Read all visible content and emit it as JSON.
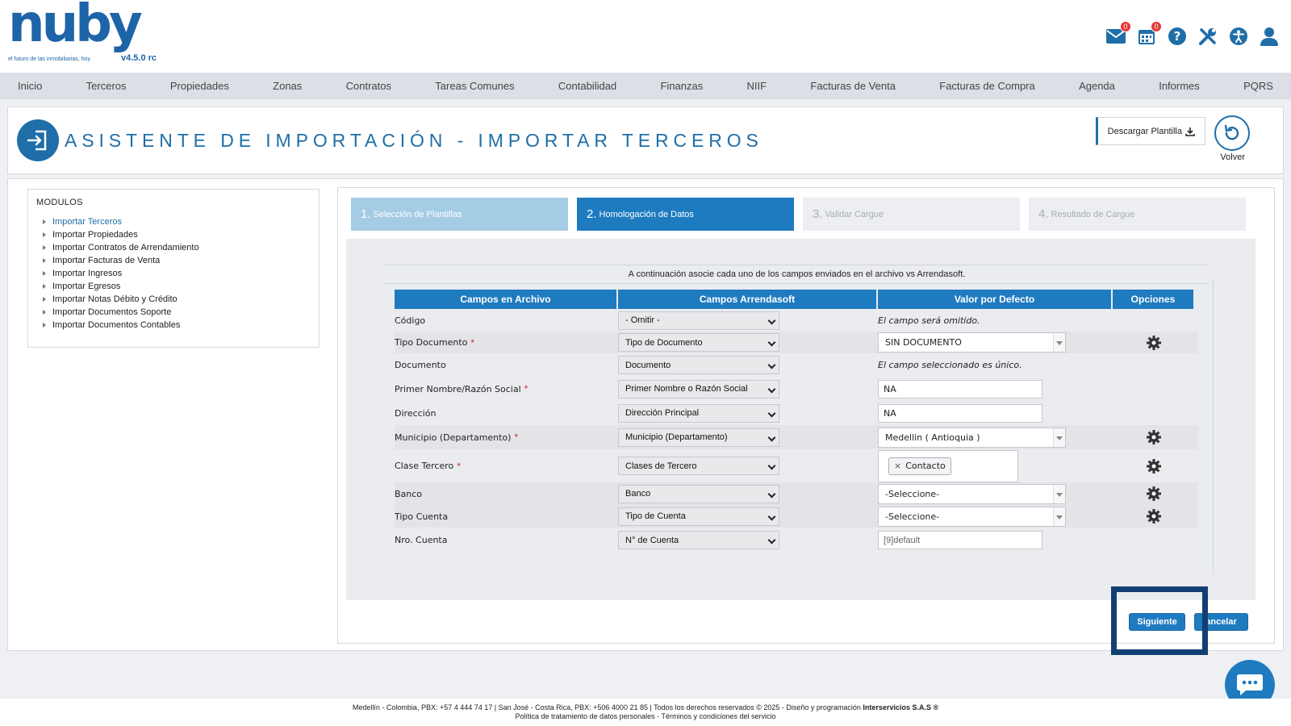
{
  "brand": {
    "name": "nuby",
    "tagline": "el futuro de las inmobiliarias, hoy",
    "version": "v4.5.0 rc"
  },
  "header_icons": [
    {
      "name": "mail-icon",
      "badge": "0"
    },
    {
      "name": "calendar-icon",
      "badge": "0"
    },
    {
      "name": "help-icon"
    },
    {
      "name": "tools-icon"
    },
    {
      "name": "accessibility-icon"
    },
    {
      "name": "user-icon"
    }
  ],
  "nav": [
    "Inicio",
    "Terceros",
    "Propiedades",
    "Zonas",
    "Contratos",
    "Tareas Comunes",
    "Contabilidad",
    "Finanzas",
    "NIIF",
    "Facturas de Venta",
    "Facturas de Compra",
    "Agenda",
    "Informes",
    "PQRS"
  ],
  "page": {
    "title": "ASISTENTE DE IMPORTACIÓN - IMPORTAR TERCEROS",
    "download_label": "Descargar Plantilla",
    "back_label": "Volver"
  },
  "modules": {
    "title": "MODULOS",
    "items": [
      "Importar Terceros",
      "Importar Propiedades",
      "Importar Contratos de Arrendamiento",
      "Importar Facturas de Venta",
      "Importar Ingresos",
      "Importar Egresos",
      "Importar Notas Débito y Crédito",
      "Importar Documentos Soporte",
      "Importar Documentos Contables"
    ],
    "active_index": 0
  },
  "steps": [
    {
      "num": "1.",
      "label": "Selección de Plantillas",
      "state": "done"
    },
    {
      "num": "2.",
      "label": "Homologación de Datos",
      "state": "active"
    },
    {
      "num": "3.",
      "label": "Validar Cargue",
      "state": "pending"
    },
    {
      "num": "4.",
      "label": "Resultado de Cargue",
      "state": "pending"
    }
  ],
  "instruction": "A continuación asocie cada uno de los campos enviados en el archivo vs Arrendasoft.",
  "table": {
    "headers": [
      "Campos en Archivo",
      "Campos Arrendasoft",
      "Valor por Defecto",
      "Opciones"
    ],
    "rows": [
      {
        "field": "Código",
        "required": false,
        "mapping": "- Omitir -",
        "default": "El campo será omitido."
      },
      {
        "field": "Tipo Documento",
        "required": true,
        "mapping": "Tipo de Documento",
        "default": "SIN DOCUMENTO"
      },
      {
        "field": "Documento",
        "required": false,
        "mapping": "Documento",
        "default": "El campo seleccionado es único."
      },
      {
        "field": "Primer Nombre/Razón Social",
        "required": true,
        "mapping": "Primer Nombre o Razón Social",
        "default": "NA"
      },
      {
        "field": "Dirección",
        "required": false,
        "mapping": "Dirección Principal",
        "default": "NA"
      },
      {
        "field": "Municipio (Departamento)",
        "required": true,
        "mapping": "Municipio (Departamento)",
        "default": "Medellin ( Antioquia )"
      },
      {
        "field": "Clase Tercero",
        "required": true,
        "mapping": "Clases de Tercero",
        "default": "Contacto"
      },
      {
        "field": "Banco",
        "required": false,
        "mapping": "Banco",
        "default": "-Seleccione-"
      },
      {
        "field": "Tipo Cuenta",
        "required": false,
        "mapping": "Tipo de Cuenta",
        "default": "-Seleccione-"
      },
      {
        "field": "Nro. Cuenta",
        "required": false,
        "mapping": "N° de Cuenta",
        "default": "[9]default"
      }
    ],
    "required_mark": "*",
    "remove_tag": "×"
  },
  "buttons": {
    "next": "Siguiente",
    "cancel": "ancelar"
  },
  "footer": {
    "line1": "Medellín - Colombia, PBX: +57 4 444 74 17 | San José - Costa Rica, PBX: +506 4000 21 85 | Todos los derechos reservados © 2025 - Diseño y programación",
    "line1_bold": "Interservicios S.A.S ®",
    "line2": "Política de tratamiento de datos personales - Términos y condiciones del servicio"
  },
  "colors": {
    "primary": "#1f7bc0",
    "title": "#1f6ea8",
    "highlight": "#123f72",
    "badge": "#e53935"
  }
}
